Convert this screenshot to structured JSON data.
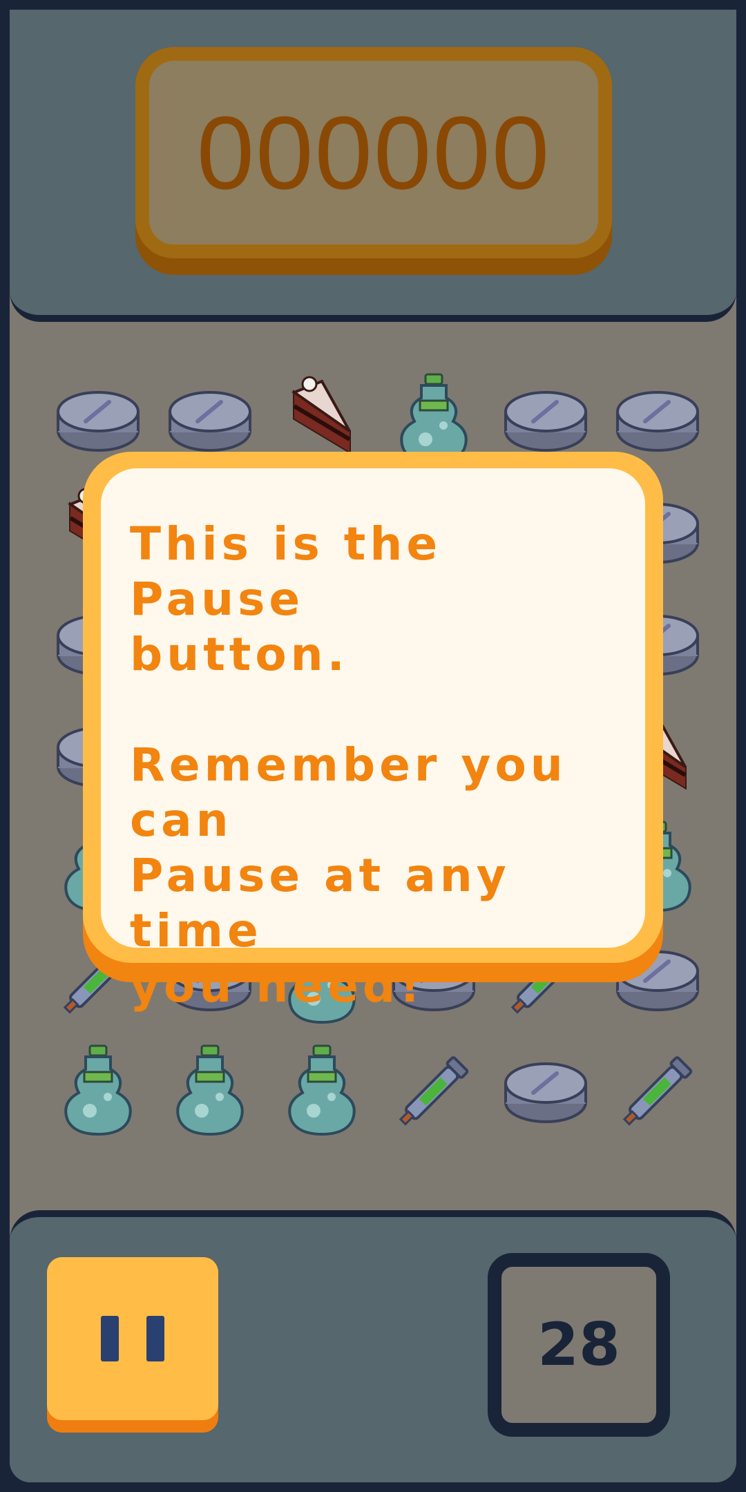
{
  "score": {
    "value": "000000"
  },
  "tutorial": {
    "message": "This is the Pause\nbutton.\n\nRemember you can\nPause at any time\nyou need!"
  },
  "moves": {
    "value": "28"
  },
  "pause": {
    "icon": "pause-icon"
  },
  "board": {
    "columns": 6,
    "rows": [
      [
        "pill",
        "pill",
        "cake",
        "bottle",
        "pill",
        "pill"
      ],
      [
        "cake",
        null,
        null,
        null,
        null,
        "pill"
      ],
      [
        "pill",
        null,
        null,
        null,
        null,
        "pill"
      ],
      [
        "pill",
        null,
        null,
        null,
        null,
        "cake"
      ],
      [
        "bottle",
        null,
        null,
        null,
        null,
        "bottle"
      ],
      [
        "syringe",
        "pill",
        "bottle",
        "pill",
        "syringe",
        "pill"
      ],
      [
        "bottle",
        "bottle",
        "bottle",
        "syringe",
        "pill",
        "syringe"
      ]
    ]
  },
  "colors": {
    "frame": "#1a2438",
    "panel": "#56676d",
    "dialog_orange": "#f28410",
    "dialog_yellow": "#ffbd47",
    "dialog_cream": "#fff8ec"
  }
}
